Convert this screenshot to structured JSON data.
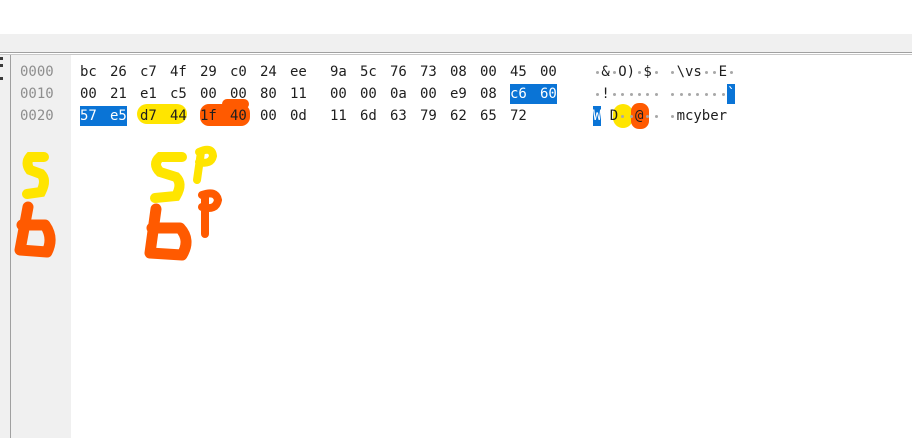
{
  "rows": [
    {
      "offset": "0000",
      "hex": [
        "bc",
        "26",
        "c7",
        "4f",
        "29",
        "c0",
        "24",
        "ee",
        "9a",
        "5c",
        "76",
        "73",
        "08",
        "00",
        "45",
        "00"
      ],
      "ascii": [
        "",
        "&",
        "",
        "O",
        ")",
        "",
        "$",
        "",
        "",
        "\\",
        "v",
        "s",
        "",
        "",
        "E",
        ""
      ]
    },
    {
      "offset": "0010",
      "hex": [
        "00",
        "21",
        "e1",
        "c5",
        "00",
        "00",
        "80",
        "11",
        "00",
        "00",
        "0a",
        "00",
        "e9",
        "08",
        "c6",
        "60"
      ],
      "ascii": [
        "",
        "!",
        "",
        "",
        "",
        "",
        "",
        "",
        "",
        "",
        "",
        "",
        "",
        "",
        "",
        "`"
      ]
    },
    {
      "offset": "0020",
      "hex": [
        "57",
        "e5",
        "d7",
        "44",
        "1f",
        "40",
        "00",
        "0d",
        "11",
        "6d",
        "63",
        "79",
        "62",
        "65",
        "72"
      ],
      "ascii": [
        "W",
        "",
        "D",
        "",
        "",
        "@",
        "",
        "",
        "",
        "m",
        "c",
        "y",
        "b",
        "e",
        "r"
      ]
    }
  ],
  "colors": {
    "selection": "#0a74d6",
    "highlight_yellow": "#ffe500",
    "highlight_orange": "#ff5a00"
  },
  "annotations": {
    "s_letter": "s",
    "b_letter": "b",
    "sp_text": "sp",
    "bp_text": "bp"
  }
}
